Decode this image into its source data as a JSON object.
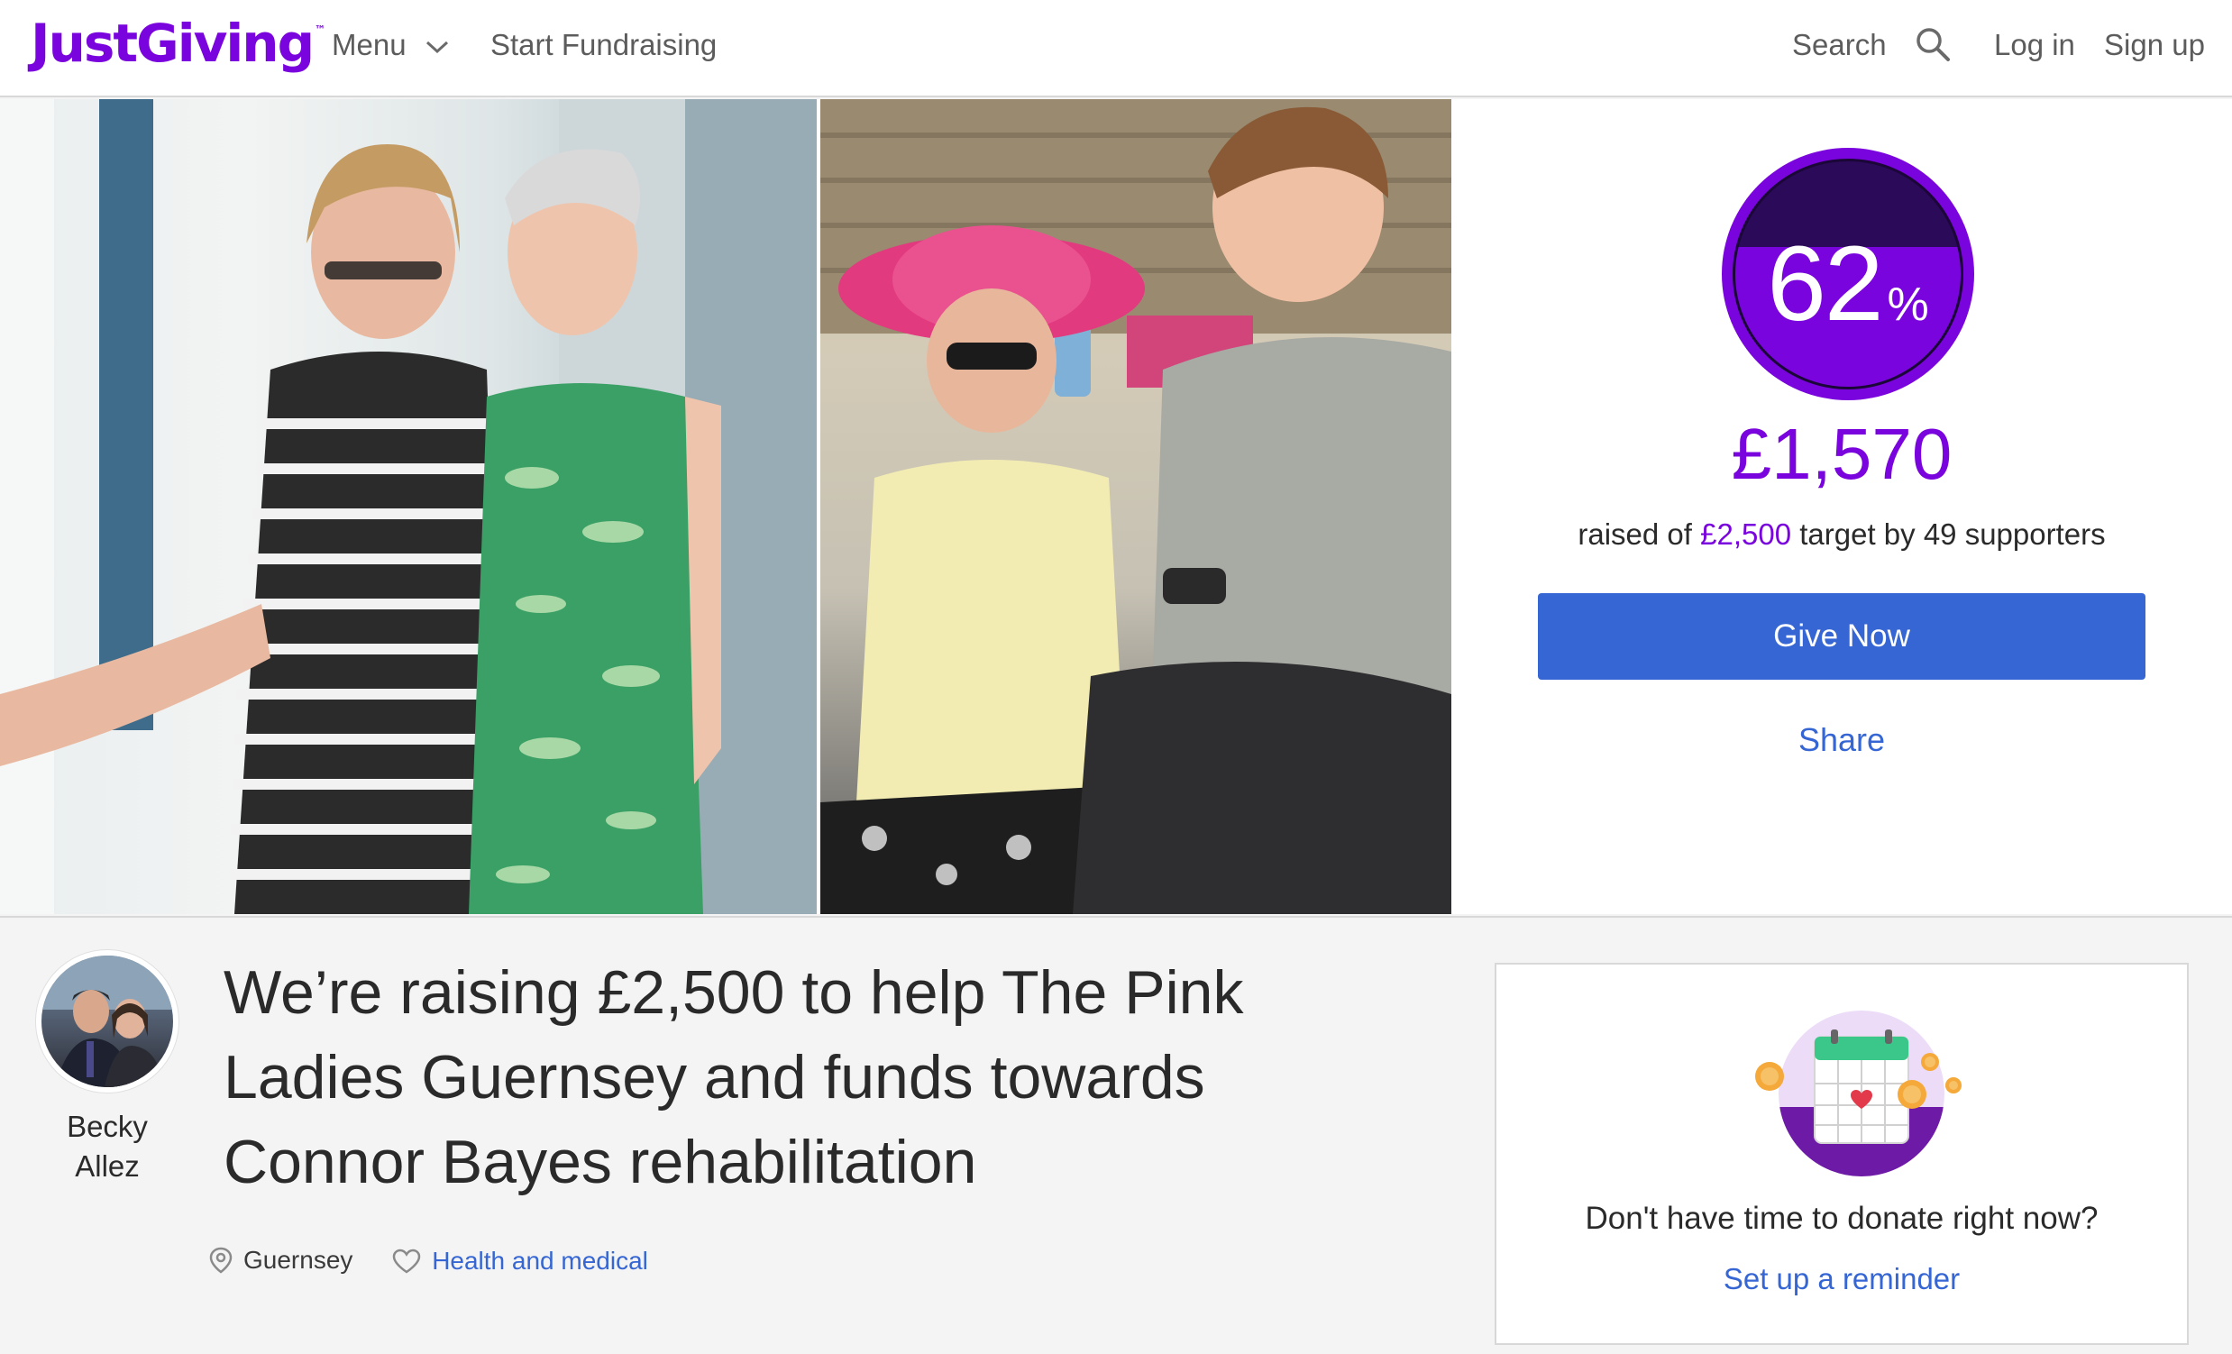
{
  "header": {
    "logo": "JustGiving",
    "logo_tm": "™",
    "menu_label": "Menu",
    "start_label": "Start Fundraising",
    "search_label": "Search",
    "login_label": "Log in",
    "signup_label": "Sign up"
  },
  "progress": {
    "percent": 62,
    "percent_text": "62",
    "percent_sign": "%",
    "raised": "£1,570",
    "raised_prefix": "raised of",
    "target": "£2,500",
    "target_by": "target by",
    "supporters": "49 supporters"
  },
  "actions": {
    "give_now": "Give Now",
    "share": "Share"
  },
  "page": {
    "owner_first": "Becky",
    "owner_last": "Allez",
    "title": "We’re raising £2,500 to help The Pink Ladies Guernsey and funds towards Connor Bayes rehabilitation",
    "location": "Guernsey",
    "category": "Health and medical"
  },
  "reminder": {
    "text": "Don't have time to donate right now?",
    "link": "Set up a reminder"
  },
  "colors": {
    "brand": "#7a04dd",
    "button": "#3566d4",
    "link": "#3566d4"
  }
}
